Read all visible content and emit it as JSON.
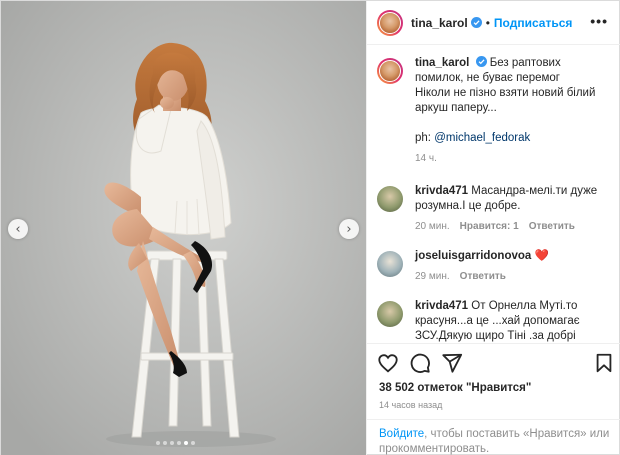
{
  "header": {
    "username": "tina_karol",
    "separator": "•",
    "follow_label": "Подписаться",
    "more_icon": "ellipsis-icon"
  },
  "caption": {
    "username": "tina_karol",
    "text": "Без раптових помилок, не буває перемог\nНіколи не пізно взяти новий білий аркуш паперу...",
    "credit_prefix": "ph: ",
    "credit_handle": "@michael_fedorak",
    "time": "14 ч."
  },
  "comments": [
    {
      "username": "krivda471",
      "text": "Масандра-мелі.ти дуже розумна.І це добре.",
      "time": "20 мин.",
      "likes": "Нравится: 1",
      "reply": "Ответить"
    },
    {
      "username": "joseluisgarridonovoa",
      "text": "❤️",
      "time": "29 мин.",
      "reply": "Ответить"
    },
    {
      "username": "krivda471",
      "text": "От Орнелла Муті.то красуня...а це ...хай допомагає ЗСУ.Дякую щиро Тіні .за добрі вчинки і"
    }
  ],
  "stats": {
    "likes": "38 502 отметок \"Нравится\"",
    "time": "14 часов назад"
  },
  "login": {
    "link": "Войдите",
    "text": ", чтобы поставить «Нравится» или прокомментировать."
  },
  "carousel": {
    "prev_icon": "chevron-left-icon",
    "next_icon": "chevron-right-icon",
    "total_slides": 6,
    "active_slide": 5
  },
  "colors": {
    "accent": "#0095f6",
    "verified": "#3897f0",
    "muted": "#8e8e8e",
    "text": "#262626"
  }
}
